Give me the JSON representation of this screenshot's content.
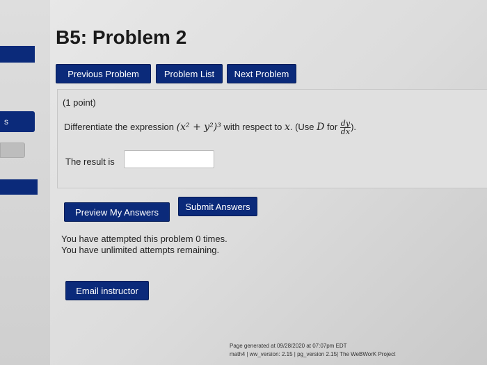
{
  "sidebar": {
    "tab_label": "s"
  },
  "header": {
    "title": "B5: Problem 2"
  },
  "nav": {
    "previous": "Previous Problem",
    "list": "Problem List",
    "next": "Next Problem"
  },
  "problem": {
    "points": "(1 point)",
    "prefix": "Differentiate the expression",
    "expression": "(x² + y²)³",
    "middle": "with respect to",
    "variable": "x",
    "use_prefix": ". (Use",
    "use_symbol": "D",
    "use_for": "for",
    "frac_num": "dy",
    "frac_den": "dx",
    "use_suffix": ").",
    "result_label": "The result is",
    "answer_value": ""
  },
  "actions": {
    "preview": "Preview My Answers",
    "submit": "Submit Answers",
    "email": "Email instructor"
  },
  "status": {
    "attempts": "You have attempted this problem 0 times.",
    "remaining": "You have unlimited attempts remaining."
  },
  "footer": {
    "generated": "Page generated at 09/28/2020 at 07:07pm EDT",
    "versions": "math4 | ww_version: 2.15 | pg_version 2.15| The WeBWorK Project"
  }
}
